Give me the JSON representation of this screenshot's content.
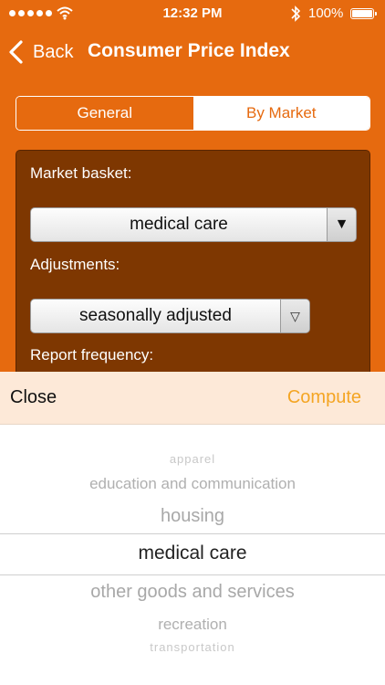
{
  "status_bar": {
    "time": "12:32 PM",
    "battery_text": "100%",
    "signal_dots": 5
  },
  "nav": {
    "back_label": "Back",
    "title": "Consumer Price Index"
  },
  "tabs": [
    {
      "label": "General",
      "selected": false
    },
    {
      "label": "By Market",
      "selected": true
    }
  ],
  "form": {
    "market_basket": {
      "label": "Market basket:",
      "value": "medical care"
    },
    "adjustments": {
      "label": "Adjustments:",
      "value": "seasonally adjusted"
    },
    "report_frequency": {
      "label": "Report frequency:"
    }
  },
  "toolbar": {
    "close_label": "Close",
    "compute_label": "Compute"
  },
  "picker": {
    "items": [
      "apparel",
      "education and communication",
      "housing",
      "medical care",
      "other goods and services",
      "recreation",
      "transportation"
    ],
    "selected_index": 3
  },
  "colors": {
    "primary": "#e66a0f",
    "panel": "#7e3701",
    "compute": "#f4a523",
    "toolbar_bg": "#fde9d8"
  }
}
